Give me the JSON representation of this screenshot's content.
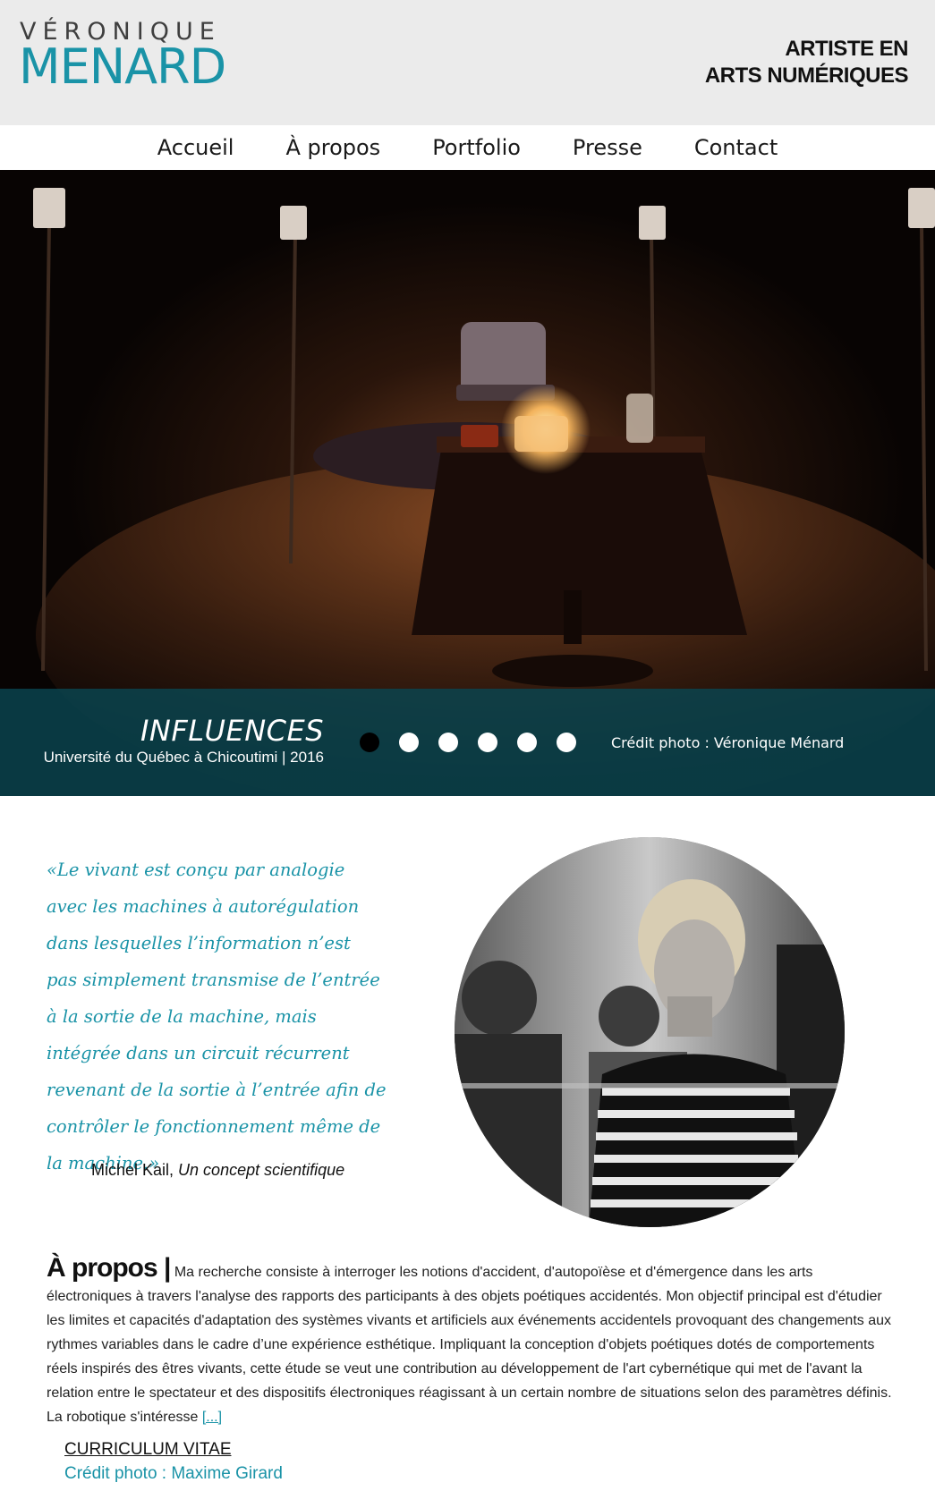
{
  "header": {
    "logo_first": "VÉRONIQUE",
    "logo_last": "MENARD",
    "tagline_line1": "ARTISTE EN",
    "tagline_line2": "ARTS NUMÉRIQUES"
  },
  "nav": {
    "items": [
      {
        "label": "Accueil"
      },
      {
        "label": "À propos"
      },
      {
        "label": "Portfolio"
      },
      {
        "label": "Presse"
      },
      {
        "label": "Contact"
      }
    ]
  },
  "slider": {
    "title": "INFLUENCES",
    "subtitle": "Université du Québec à Chicoutimi | 2016",
    "credit": "Crédit photo : Véronique Ménard",
    "slide_count": 6,
    "active_slide": 1
  },
  "quote": {
    "text": "«Le vivant est conçu par analogie avec les machines à autorégulation dans lesquelles l’information n’est pas simplement transmise de l’entrée à la sortie de la machine, mais intégrée dans un circuit récurrent revenant de la sortie à l’entrée afin de contrôler le fonctionnement même de la machine.»",
    "author": "Michel Kail,",
    "work": "Un concept scientifique"
  },
  "about": {
    "heading": "À propos |",
    "text": "Ma recherche consiste à interroger les notions d'accident, d'autopoïèse et d'émergence dans les arts électroniques à travers l'analyse des rapports des participants à des objets poétiques accidentés. Mon objectif principal est d'étudier les limites et capacités d'adaptation des systèmes vivants et artificiels aux événements accidentels provoquant des changements aux rythmes variables dans le cadre d’une expérience esthétique. Impliquant la conception d'objets poétiques dotés de comportements réels inspirés des êtres vivants, cette étude se veut une contribution au développement de l'art cybernétique qui met de l'avant la relation entre le spectateur et des dispositifs électroniques réagissant à un certain nombre de situations selon des paramètres définis. La robotique s'intéresse",
    "more_link": "[...]",
    "cv_link": "CURRICULUM VITAE",
    "photo_credit": "Crédit photo : Maxime Girard"
  },
  "colors": {
    "accent": "#1a93a7",
    "header_bg": "#ebebeb",
    "caption_bar": "#0a4650"
  }
}
